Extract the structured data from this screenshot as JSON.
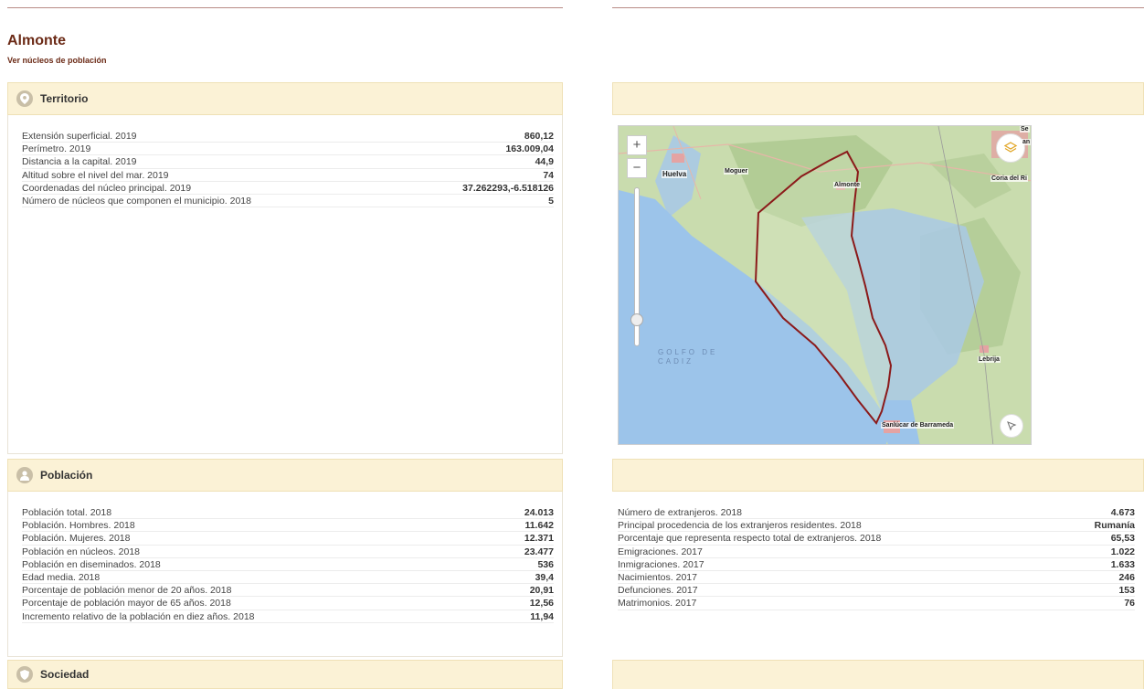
{
  "page": {
    "title": "Almonte",
    "sublink": "Ver núcleos de población"
  },
  "territorio": {
    "header": "Territorio",
    "icon": "location-pin-icon",
    "rows": [
      {
        "label": "Extensión superficial. 2019",
        "value": "860,12"
      },
      {
        "label": "Perímetro. 2019",
        "value": "163.009,04"
      },
      {
        "label": "Distancia a la capital. 2019",
        "value": "44,9"
      },
      {
        "label": "Altitud sobre el nivel del mar. 2019",
        "value": "74"
      },
      {
        "label": "Coordenadas del núcleo principal. 2019",
        "value": "37.262293,-6.518126"
      },
      {
        "label": "Número de núcleos que componen el municipio. 2018",
        "value": "5"
      }
    ]
  },
  "poblacion": {
    "header": "Población",
    "icon": "person-icon",
    "rows_left": [
      {
        "label": "Población total. 2018",
        "value": "24.013"
      },
      {
        "label": "Población. Hombres. 2018",
        "value": "11.642"
      },
      {
        "label": "Población. Mujeres. 2018",
        "value": "12.371"
      },
      {
        "label": "Población en núcleos. 2018",
        "value": "23.477"
      },
      {
        "label": "Población en diseminados. 2018",
        "value": "536"
      },
      {
        "label": "Edad media. 2018",
        "value": "39,4"
      },
      {
        "label": "Porcentaje de población menor de 20 años. 2018",
        "value": "20,91"
      },
      {
        "label": "Porcentaje de población mayor de 65 años. 2018",
        "value": "12,56"
      },
      {
        "label": "Incremento relativo de la población en diez años. 2018",
        "value": "11,94"
      }
    ],
    "rows_right": [
      {
        "label": "Número de extranjeros. 2018",
        "value": "4.673"
      },
      {
        "label": "Principal procedencia de los extranjeros residentes. 2018",
        "value": "Rumanía"
      },
      {
        "label": "Porcentaje que representa respecto total de extranjeros. 2018",
        "value": "65,53"
      },
      {
        "label": "Emigraciones. 2017",
        "value": "1.022"
      },
      {
        "label": "Inmigraciones. 2017",
        "value": "1.633"
      },
      {
        "label": "Nacimientos. 2017",
        "value": "246"
      },
      {
        "label": "Defunciones. 2017",
        "value": "153"
      },
      {
        "label": "Matrimonios. 2017",
        "value": "76"
      }
    ]
  },
  "sociedad": {
    "header": "Sociedad",
    "icon": "shield-icon"
  },
  "map": {
    "zoom_in": "+",
    "zoom_out": "−",
    "labels": {
      "huelva": "Huelva",
      "moguer": "Moguer",
      "almonte": "Almonte",
      "coria": "Coria del Ri",
      "lebrija": "Lebrija",
      "sanlucar": "Sanlúcar de Barrameda",
      "se": "Se",
      "an": "an",
      "gulf_line1": "GOLFO DE",
      "gulf_line2": "CADIZ"
    },
    "colors": {
      "sea": "#9cc4ea",
      "land": "#c9dcae",
      "boundary": "#8b1a1a",
      "marsh": "#a9c9e5"
    }
  }
}
